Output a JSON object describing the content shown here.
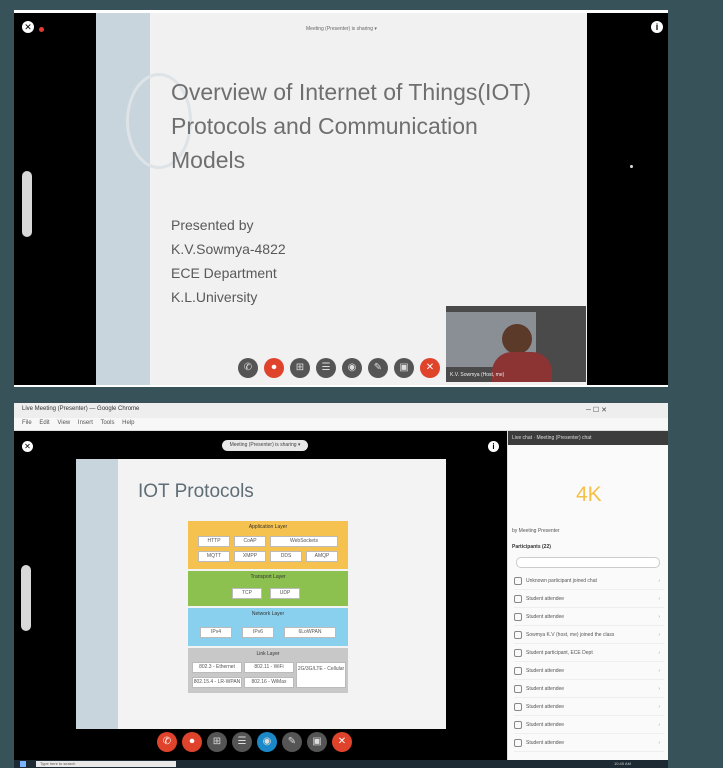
{
  "panel1": {
    "slide": {
      "title_lines": [
        "Overview of Internet of Things(IOT)",
        "Protocols and Communication",
        "Models"
      ],
      "presenter": [
        "Presented by",
        "K.V.Sowmya-4822",
        "ECE Department",
        "K.L.University"
      ]
    },
    "top_caption": "Meeting (Presenter) is sharing ▾",
    "video_label": "K.V. Sowmya (Host, me)",
    "controls": [
      "✆",
      "⏺",
      "⊞",
      "☰",
      "◉",
      "✎",
      "▣",
      "✕"
    ]
  },
  "panel2": {
    "app_title": "Live Meeting (Presenter) — Google Chrome",
    "window_controls": "─   ☐   ✕",
    "menu": "File  Edit  View  Insert  Tools  Help",
    "caption": "Meeting (Presenter) is sharing ▾",
    "slide_title": "IOT Protocols",
    "diagram": {
      "application_layer": {
        "label": "Application Layer",
        "chips": [
          "HTTP",
          "CoAP",
          "WebSockets",
          "MQTT",
          "XMPP",
          "DDS",
          "AMQP"
        ]
      },
      "transport_layer": {
        "label": "Transport Layer",
        "chips": [
          "TCP",
          "UDP"
        ]
      },
      "network_layer": {
        "label": "Network Layer",
        "chips": [
          "IPv4",
          "IPv6",
          "6LoWPAN"
        ]
      },
      "link_layer": {
        "label": "Link Layer",
        "chips": [
          "802.3 - Ethernet",
          "802.11 - WiFi",
          "802.16 - WiMax",
          "802.15.4 - LR-WPAN",
          "2G/3G/LTE - Cellular"
        ]
      }
    },
    "controls": [
      "✆",
      "⏺",
      "⊞",
      "☰",
      "◉",
      "✎",
      "▣",
      "✕"
    ],
    "chat": {
      "header": "Live chat · Meeting (Presenter) chat",
      "highlight": "4K",
      "owner": "by Meeting Presenter",
      "list_heading": "Participants (22)",
      "items": [
        "Unknown participant joined chat",
        "Student attendee",
        "Student attendee",
        "Sowmya K.V (host, me) joined the class",
        "Student participant, ECE Dept",
        "Student attendee",
        "Student attendee",
        "Student attendee",
        "Student attendee",
        "Student attendee"
      ]
    },
    "taskbar_search": "Type here to search",
    "tray_time": "10:45 AM"
  }
}
